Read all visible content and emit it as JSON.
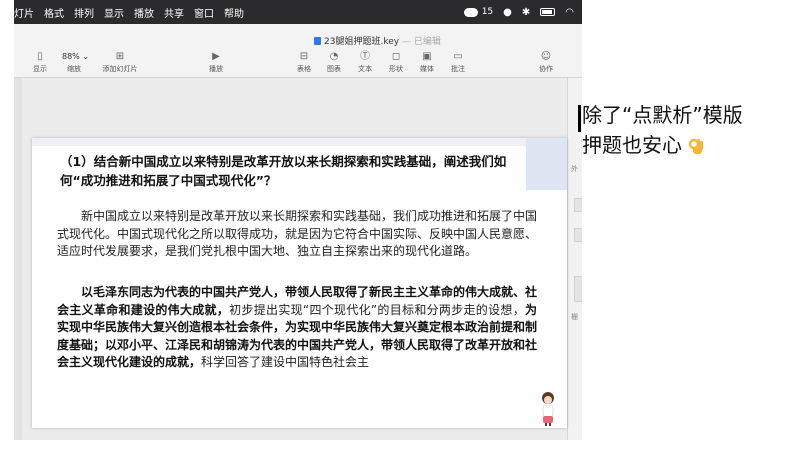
{
  "menubar": {
    "items": [
      "灯片",
      "格式",
      "排列",
      "显示",
      "播放",
      "共享",
      "窗口",
      "帮助"
    ],
    "wechat_count": "15"
  },
  "window": {
    "filename": "23腿姐押题班.key",
    "edited_status": "— 已编辑"
  },
  "toolbar": {
    "zoom": "88%",
    "left_tools": [
      {
        "label": "显示",
        "icon": "sidebar-icon"
      },
      {
        "label": "缩放",
        "icon": "zoom-icon"
      },
      {
        "label": "添加幻灯片",
        "icon": "add-slide-icon"
      }
    ],
    "play": {
      "label": "播放",
      "icon": "play-icon"
    },
    "insert_tools": [
      {
        "label": "表格",
        "icon": "table-icon"
      },
      {
        "label": "图表",
        "icon": "chart-icon"
      },
      {
        "label": "文本",
        "icon": "text-icon"
      },
      {
        "label": "形状",
        "icon": "shape-icon"
      },
      {
        "label": "媒体",
        "icon": "media-icon"
      },
      {
        "label": "批注",
        "icon": "comment-icon"
      }
    ],
    "collaborate": {
      "label": "协作",
      "icon": "collaborate-icon"
    }
  },
  "right_panel": {
    "partial_labels": [
      "外",
      "栅"
    ]
  },
  "slide": {
    "question": "（1）结合新中国成立以来特别是改革开放以来长期探索和实践基础，阐述我们如何“成功推进和拓展了中国式现代化”？",
    "para1": "新中国成立以来特别是改革开放以来长期探索和实践基础，我们成功推进和拓展了中国式现代化。中国式现代化之所以取得成功，就是因为它符合中国实际、反映中国人民意愿、适应时代发展要求，是我们党扎根中国大地、独立自主探索出来的现代化道路。",
    "para2_bold_1": "以毛泽东同志为代表的中国共产党人，带领人民取得了新民主主义革命的伟大成就、社会主义革命和建设的伟大成就，",
    "para2_normal_1": "初步提出实现“四个现代化”的目标和分两步走的设想，",
    "para2_bold_2": "为实现中华民族伟大复兴创造根本社会条件，为实现中华民族伟大复兴奠定根本政治前提和制度基础；以邓小平、江泽民和胡锦涛为代表的中国共产党人，带领人民取得了改革开放和社会主义现代化建设的成就，",
    "para2_normal_2": "科学回答了建设中国特色社会主"
  },
  "caption": {
    "line1": "除了“点默析”模版",
    "line2": "押题也安心"
  },
  "colors": {
    "menubar_bg": "#2b2b2d",
    "window_bg": "#ececec",
    "slide_accent": "#dde6f2"
  }
}
